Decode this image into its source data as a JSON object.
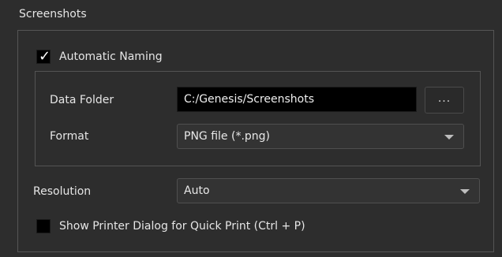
{
  "screenshots": {
    "title": "Screenshots",
    "automatic_naming": {
      "label": "Automatic Naming",
      "checked": true
    },
    "data_folder": {
      "label": "Data Folder",
      "value": "C:/Genesis/Screenshots",
      "browse_label": "..."
    },
    "format": {
      "label": "Format",
      "value": "PNG file (*.png)"
    },
    "resolution": {
      "label": "Resolution",
      "value": "Auto"
    },
    "show_printer_dialog": {
      "label": "Show Printer Dialog for Quick Print (Ctrl + P)",
      "checked": false
    }
  },
  "colors": {
    "background": "#2d2d2d",
    "input_background": "#000000",
    "border": "#555555",
    "text": "#e6e6e6"
  }
}
